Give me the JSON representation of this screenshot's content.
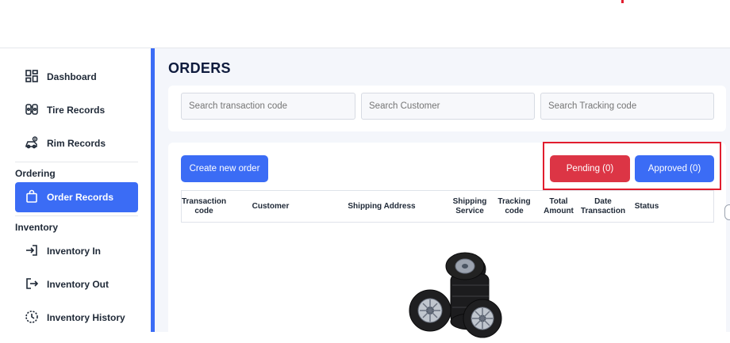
{
  "sidebar": {
    "items": [
      {
        "label": "Dashboard",
        "icon": "dashboard-grid-icon"
      },
      {
        "label": "Tire Records",
        "icon": "tire-records-icon"
      },
      {
        "label": "Rim Records",
        "icon": "rim-records-icon"
      }
    ],
    "sections": [
      {
        "title": "Ordering",
        "items": [
          {
            "label": "Order Records",
            "icon": "shopping-bag-icon",
            "active": true
          }
        ]
      },
      {
        "title": "Inventory",
        "items": [
          {
            "label": "Inventory In",
            "icon": "sign-in-icon"
          },
          {
            "label": "Inventory Out",
            "icon": "sign-out-icon"
          },
          {
            "label": "Inventory History",
            "icon": "history-icon"
          }
        ]
      }
    ]
  },
  "main": {
    "title": "ORDERS",
    "search": {
      "transaction_placeholder": "Search transaction code",
      "customer_placeholder": "Search Customer",
      "tracking_placeholder": "Search Tracking code"
    },
    "create_button": "Create new order",
    "pending_button": "Pending (0)",
    "approved_button": "Approved (0)",
    "table": {
      "columns": [
        "Transaction code",
        "Customer",
        "Shipping Address",
        "Shipping Service",
        "Tracking code",
        "Total Amount",
        "Date Transaction",
        "Status"
      ]
    },
    "empty_state_icon": "tire-stack-icon"
  },
  "colors": {
    "accent": "#3b6cf5",
    "pending": "#dc3545",
    "highlight": "#e11d2e",
    "title": "#0f1b3d"
  }
}
